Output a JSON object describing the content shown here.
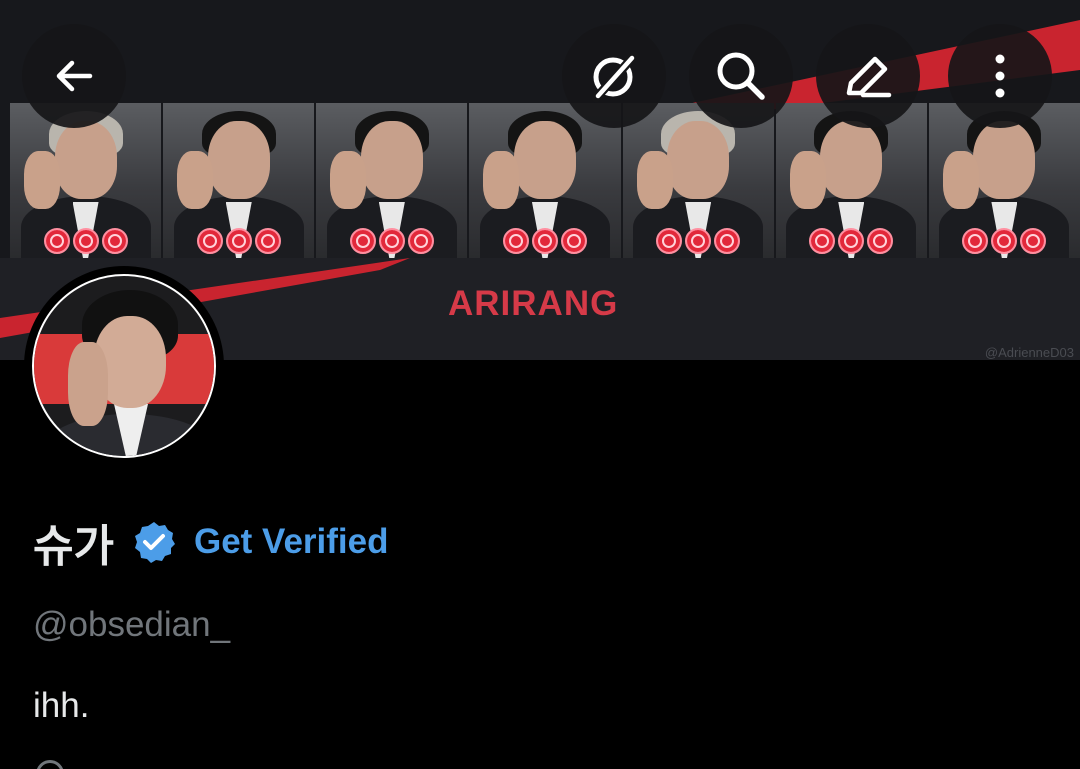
{
  "banner": {
    "title": "ARIRANG",
    "watermark": "@AdrienneD03",
    "accent_color": "#d63a48",
    "background_color": "#17181c"
  },
  "top_actions": {
    "back_icon": "arrow-left-icon",
    "grok_icon": "grok-icon",
    "search_icon": "search-icon",
    "edit_icon": "edit-pencil-icon",
    "more_icon": "more-vertical-icon"
  },
  "profile": {
    "display_name": "슈가",
    "verified_icon": "verified-badge-icon",
    "verified_color": "#4c9de8",
    "get_verified_label": "Get Verified",
    "handle": "@obsedian_",
    "bio": "ihh."
  }
}
